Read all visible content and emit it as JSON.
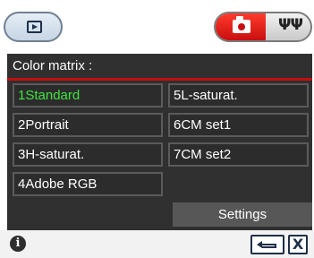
{
  "icons": {
    "playback": "playback-icon",
    "camera": "camera-icon",
    "setup": "tools-icon",
    "info": "info-icon",
    "return": "return-arrow-icon",
    "close": "close-icon"
  },
  "colors": {
    "panel_bg": "#303030",
    "accent_red": "#c20e0e",
    "selected_text": "#3fe43f",
    "settings_bg": "#575757"
  },
  "header": {
    "setup_glyph": "ΨΨ"
  },
  "panel": {
    "title": "Color matrix :",
    "options": [
      {
        "label": "1Standard",
        "selected": true
      },
      {
        "label": "2Portrait",
        "selected": false
      },
      {
        "label": "3H-saturat.",
        "selected": false
      },
      {
        "label": "4Adobe RGB",
        "selected": false
      },
      {
        "label": "5L-saturat.",
        "selected": false
      },
      {
        "label": "6CM set1",
        "selected": false
      },
      {
        "label": "7CM set2",
        "selected": false
      }
    ],
    "settings_label": "Settings"
  },
  "footer": {
    "info_glyph": "i",
    "close_glyph": "X"
  }
}
